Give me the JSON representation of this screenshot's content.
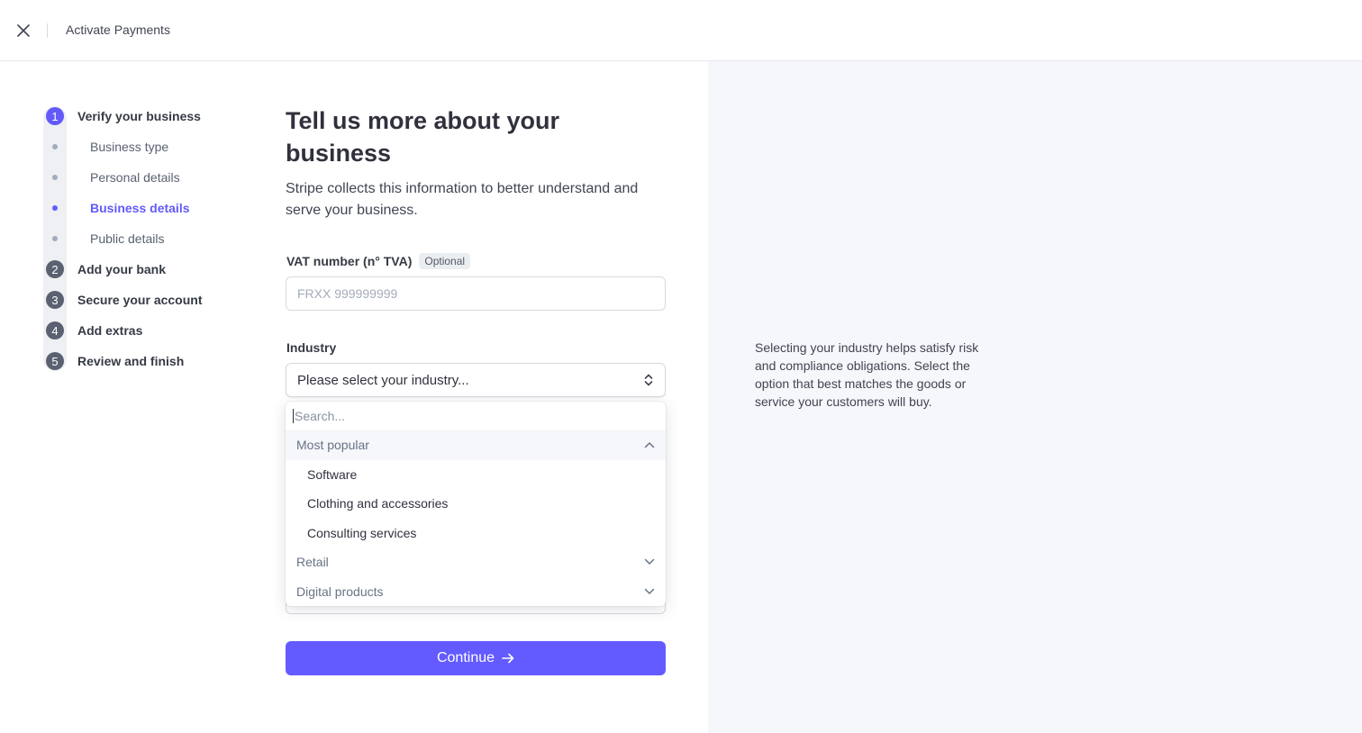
{
  "header": {
    "title": "Activate Payments",
    "close_icon": "close-icon"
  },
  "stepper": {
    "steps": [
      {
        "number": "1",
        "label": "Verify your business",
        "active": true
      },
      {
        "number": "2",
        "label": "Add your bank",
        "active": false
      },
      {
        "number": "3",
        "label": "Secure your account",
        "active": false
      },
      {
        "number": "4",
        "label": "Add extras",
        "active": false
      },
      {
        "number": "5",
        "label": "Review and finish",
        "active": false
      }
    ],
    "substeps": [
      {
        "label": "Business type",
        "active": false
      },
      {
        "label": "Personal details",
        "active": false
      },
      {
        "label": "Business details",
        "active": true
      },
      {
        "label": "Public details",
        "active": false
      }
    ]
  },
  "form": {
    "title": "Tell us more about your business",
    "subtitle": "Stripe collects this information to better understand and serve your business.",
    "vat": {
      "label": "VAT number (n° TVA)",
      "badge": "Optional",
      "placeholder": "FRXX 999999999",
      "value": ""
    },
    "industry": {
      "label": "Industry",
      "selected": "Please select your industry...",
      "search_placeholder": "Search...",
      "groups": [
        {
          "label": "Most popular",
          "expanded": true,
          "items": [
            "Software",
            "Clothing and accessories",
            "Consulting services"
          ]
        },
        {
          "label": "Retail",
          "expanded": false
        },
        {
          "label": "Digital products",
          "expanded": false
        }
      ]
    },
    "continue_label": "Continue"
  },
  "help": {
    "text": "Selecting your industry helps satisfy risk and compliance obligations. Select the option that best matches the goods or service your customers will buy."
  },
  "colors": {
    "accent": "#635bff",
    "panel_bg": "#f5f7fa"
  }
}
